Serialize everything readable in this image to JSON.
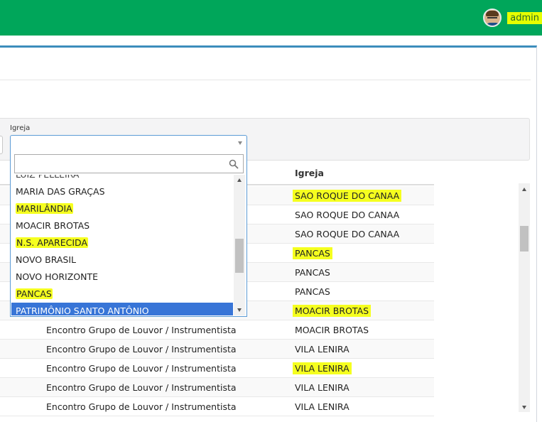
{
  "header": {
    "username": "admin",
    "bg_color": "#00a65a"
  },
  "filter": {
    "igreja_label": "Igreja",
    "search_placeholder": "",
    "partial_option": "LUIZ PELLEIRA",
    "options": [
      {
        "label": "MARIA DAS GRAÇAS",
        "highlighted": false,
        "selected": false
      },
      {
        "label": "MARILÂNDIA",
        "highlighted": true,
        "selected": false
      },
      {
        "label": "MOACIR BROTAS",
        "highlighted": false,
        "selected": false
      },
      {
        "label": "N.S. APARECIDA",
        "highlighted": true,
        "selected": false
      },
      {
        "label": "NOVO BRASIL",
        "highlighted": false,
        "selected": false
      },
      {
        "label": "NOVO HORIZONTE",
        "highlighted": false,
        "selected": false
      },
      {
        "label": "PANCAS",
        "highlighted": true,
        "selected": false
      },
      {
        "label": "PATRIMÔNIO SANTO ANTÔNIO",
        "highlighted": false,
        "selected": true
      }
    ]
  },
  "table": {
    "header_igreja": "Igreja",
    "rows": [
      {
        "evento": "",
        "igreja": "SAO ROQUE DO CANAA",
        "highlighted": true
      },
      {
        "evento": "",
        "igreja": "SAO ROQUE DO CANAA",
        "highlighted": false
      },
      {
        "evento": "",
        "igreja": "SAO ROQUE DO CANAA",
        "highlighted": false
      },
      {
        "evento": "",
        "igreja": "PANCAS",
        "highlighted": true
      },
      {
        "evento": "",
        "igreja": "PANCAS",
        "highlighted": false
      },
      {
        "evento": "",
        "igreja": "PANCAS",
        "highlighted": false
      },
      {
        "evento": "",
        "igreja": "MOACIR BROTAS",
        "highlighted": true
      },
      {
        "evento": "Encontro Grupo de Louvor / Instrumentista",
        "igreja": "MOACIR BROTAS",
        "highlighted": false
      },
      {
        "evento": "Encontro Grupo de Louvor / Instrumentista",
        "igreja": "VILA LENIRA",
        "highlighted": false
      },
      {
        "evento": "Encontro Grupo de Louvor / Instrumentista",
        "igreja": "VILA LENIRA",
        "highlighted": true
      },
      {
        "evento": "Encontro Grupo de Louvor / Instrumentista",
        "igreja": "VILA LENIRA",
        "highlighted": false
      },
      {
        "evento": "Encontro Grupo de Louvor / Instrumentista",
        "igreja": "VILA LENIRA",
        "highlighted": false
      }
    ]
  },
  "colors": {
    "highlight": "#f5ff1f",
    "selected_option": "#3875d7",
    "accent_border": "#3c8dbc"
  }
}
